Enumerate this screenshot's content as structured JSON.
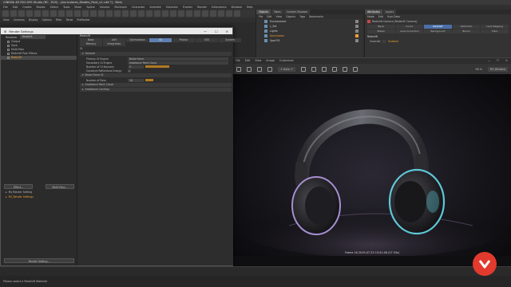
{
  "app": {
    "title": "CINEMA 4D R20.059 Studio (RC - R20) - [Auriculares_Modelo_Final_v1.c4d *] - Main",
    "menus": [
      "File",
      "Edit",
      "Create",
      "Modes",
      "Select",
      "Tools",
      "Mesh",
      "Spline",
      "Volume",
      "MoGraph",
      "Character",
      "Animate",
      "Simulate",
      "Tracker",
      "Render",
      "Extensions",
      "Window",
      "Help"
    ],
    "view_menus": [
      "View",
      "Cameras",
      "Display",
      "Options",
      "Filter",
      "Panel",
      "ProRender"
    ]
  },
  "object_manager": {
    "tabs": [
      "Objects",
      "Takes",
      "Content Browser"
    ],
    "menus": [
      "File",
      "Edit",
      "View",
      "Objects",
      "Tags",
      "Bookmarks"
    ],
    "objects": [
      {
        "name": "Environment",
        "color": "#cfcfcf"
      },
      {
        "name": "L_Set",
        "color": "#cfcfcf"
      },
      {
        "name": "Lights",
        "color": "#cfcfcf"
      },
      {
        "name": "Auriculares",
        "color": "#f0a030"
      },
      {
        "name": "Spot RS",
        "color": "#cfcfcf"
      }
    ]
  },
  "attribute_manager": {
    "tabs": [
      "Attributes",
      "Layers"
    ],
    "menus": [
      "Mode",
      "Edit",
      "User Data"
    ],
    "object_title": "Redshift Camera [Redshift Camera]",
    "buttons": [
      {
        "label": "Basic",
        "on": false
      },
      {
        "label": "Coord.",
        "on": false
      },
      {
        "label": "Redshift",
        "on": true
      },
      {
        "label": "Distortion",
        "on": false
      },
      {
        "label": "Lens Mapping",
        "on": false
      },
      {
        "label": "Bokeh",
        "on": false
      },
      {
        "label": "Lens Correction",
        "on": false
      },
      {
        "label": "Background",
        "on": false
      },
      {
        "label": "Bloom",
        "on": false
      },
      {
        "label": "Flare",
        "on": false
      }
    ],
    "section": "Redshift",
    "row_label": "Override",
    "row_value": "Enabled"
  },
  "render_settings": {
    "title": "Render Settings",
    "renderer_label": "Renderer",
    "renderer_value": "Redshift",
    "left_items": [
      {
        "label": "Output",
        "selected": false
      },
      {
        "label": "Save",
        "selected": false
      },
      {
        "label": "Multi-Pass",
        "selected": false
      },
      {
        "label": "Redshift Post Effects",
        "selected": false
      },
      {
        "label": "Redshift",
        "selected": true
      }
    ],
    "effect_button": "Effect...",
    "multipass_button": "Multi-Pass...",
    "presets": [
      {
        "label": "My Render Setting",
        "selected": false
      },
      {
        "label": "RS_Render Settings",
        "selected": true
      }
    ],
    "settings_button": "Render Setting...",
    "right_header": "Redshift",
    "tabs_row1": [
      {
        "label": "Basic",
        "on": false
      },
      {
        "label": "AOV",
        "on": false
      },
      {
        "label": "Optimization",
        "on": false
      },
      {
        "label": "GI",
        "on": true
      },
      {
        "label": "Photon",
        "on": false
      },
      {
        "label": "SSS",
        "on": false
      },
      {
        "label": "System",
        "on": false
      }
    ],
    "tabs_row2": [
      {
        "label": "Memory",
        "on": false
      },
      {
        "label": "Integration",
        "on": false
      }
    ],
    "section_label": "GI",
    "general_group": "General",
    "fields": {
      "primary_label": "Primary GI Engine",
      "primary_value": "Brute Force",
      "secondary_label": "Secondary GI Engine",
      "secondary_value": "Irradiance Point Cloud",
      "bounces_label": "Number of GI Bounces",
      "bounces_value": "3",
      "bounces_fraction": 0.3,
      "conserve_label": "Conserve Reflections Energy",
      "conserve_value": "✓"
    },
    "brute_group": "Brute Force GI",
    "rays_label": "Number of Rays",
    "rays_value": "16",
    "rays_fraction": 0.1,
    "irr_point_group": "Irradiance Point Cloud",
    "irr_cache_group": "Irradiance Caching"
  },
  "viewport": {
    "menus": [
      "File",
      "Edit",
      "View",
      "Image",
      "Customize"
    ],
    "mode_dropdown": "+ Auto +",
    "zoom_label": "96 %",
    "view_dropdown": "RS Window",
    "frame_status": "Frame 16 2019-07-25 13:41:46 (27.53s)"
  },
  "status_bar": {
    "message": "Please select a Redshift Material"
  },
  "colors": {
    "accent": "#f0a030",
    "tab_active": "#5f7fb0",
    "logo": "#e23a2e"
  }
}
